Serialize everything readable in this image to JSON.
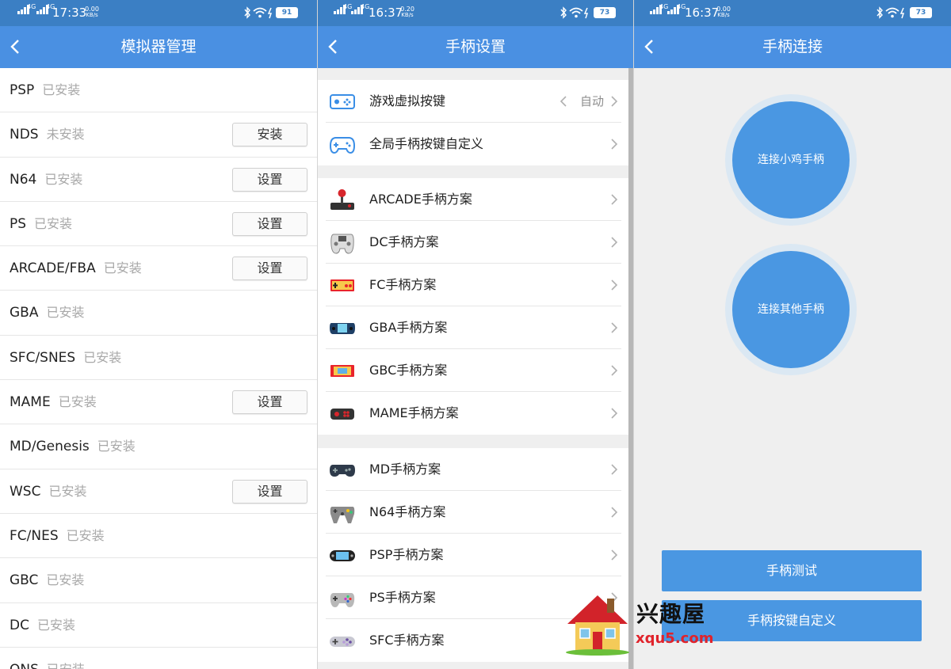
{
  "panel1": {
    "status": {
      "net1": "4G",
      "net2": "4G",
      "time": "17:33",
      "speed": "0.00",
      "speed_unit": "KB/s",
      "battery": "91"
    },
    "title": "模拟器管理",
    "emulators": [
      {
        "name": "PSP",
        "status": "已安装",
        "button": ""
      },
      {
        "name": "NDS",
        "status": "未安装",
        "button": "安装"
      },
      {
        "name": "N64",
        "status": "已安装",
        "button": "设置"
      },
      {
        "name": "PS",
        "status": "已安装",
        "button": "设置"
      },
      {
        "name": "ARCADE/FBA",
        "status": "已安装",
        "button": "设置"
      },
      {
        "name": "GBA",
        "status": "已安装",
        "button": ""
      },
      {
        "name": "SFC/SNES",
        "status": "已安装",
        "button": ""
      },
      {
        "name": "MAME",
        "status": "已安装",
        "button": "设置"
      },
      {
        "name": "MD/Genesis",
        "status": "已安装",
        "button": ""
      },
      {
        "name": "WSC",
        "status": "已安装",
        "button": "设置"
      },
      {
        "name": "FC/NES",
        "status": "已安装",
        "button": ""
      },
      {
        "name": "GBC",
        "status": "已安装",
        "button": ""
      },
      {
        "name": "DC",
        "status": "已安装",
        "button": ""
      },
      {
        "name": "ONS",
        "status": "已安装",
        "button": ""
      }
    ]
  },
  "panel2": {
    "status": {
      "net1": "4G",
      "net2": "4G",
      "time": "16:37",
      "speed": "0.20",
      "speed_unit": "KB/s",
      "battery": "73"
    },
    "title": "手柄设置",
    "group1": [
      {
        "label": "游戏虚拟按键",
        "value": "自动",
        "icon": "virtual-gamepad-icon"
      },
      {
        "label": "全局手柄按键自定义",
        "value": "",
        "icon": "gamepad-outline-icon"
      }
    ],
    "group2": [
      {
        "label": "ARCADE手柄方案",
        "icon": "arcade-joystick-icon"
      },
      {
        "label": "DC手柄方案",
        "icon": "dc-controller-icon"
      },
      {
        "label": "FC手柄方案",
        "icon": "fc-controller-icon"
      },
      {
        "label": "GBA手柄方案",
        "icon": "gba-console-icon"
      },
      {
        "label": "GBC手柄方案",
        "icon": "gbc-console-icon"
      },
      {
        "label": "MAME手柄方案",
        "icon": "mame-arcade-icon"
      }
    ],
    "group3": [
      {
        "label": "MD手柄方案",
        "icon": "md-controller-icon"
      },
      {
        "label": "N64手柄方案",
        "icon": "n64-controller-icon"
      },
      {
        "label": "PSP手柄方案",
        "icon": "psp-console-icon"
      },
      {
        "label": "PS手柄方案",
        "icon": "ps-controller-icon"
      },
      {
        "label": "SFC手柄方案",
        "icon": "sfc-controller-icon"
      }
    ]
  },
  "panel3": {
    "status": {
      "net1": "4G",
      "net2": "4G",
      "time": "16:37",
      "speed": "0.00",
      "speed_unit": "KB/s",
      "battery": "73"
    },
    "title": "手柄连接",
    "connect_xiaoji": "连接小鸡手柄",
    "connect_other": "连接其他手柄",
    "test_button": "手柄测试",
    "custom_button": "手柄按键自定义"
  },
  "watermark": {
    "cn": "兴趣屋",
    "url": "xqu5.com"
  },
  "colors": {
    "status_bar": "#3b7fc4",
    "title_bar": "#4a90e2",
    "primary_button": "#4a97e2",
    "secondary_text": "#a8a8a8"
  }
}
